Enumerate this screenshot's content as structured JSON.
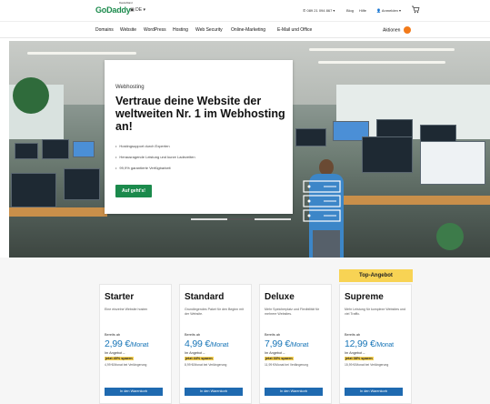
{
  "topbar": {
    "logo": "GoDaddy",
    "logo_tag": "Deutschland",
    "language": "DE",
    "phone": "089 21 094 867",
    "blog": "Blog",
    "help": "Hilfe",
    "account": "Anmelden"
  },
  "nav": {
    "items": [
      "Domains",
      "Website",
      "WordPress",
      "Hosting",
      "Web Security",
      "Online-Marketing",
      "E-Mail und Office"
    ],
    "actions_label": "Aktionen"
  },
  "hero": {
    "eyebrow": "Webhosting",
    "title": "Vertraue deine Website der weltweiten Nr. 1 im Webhosting an!",
    "bullets": [
      "Hostingsupport durch Experten",
      "Herausragende Leistung und kurze Ladezeiten",
      "99,9% garantierte Verfügbarkeit"
    ],
    "cta": "Auf geht's!"
  },
  "pricing": {
    "top_offer": "Top-Angebot",
    "plans": [
      {
        "name": "Starter",
        "desc": "Eine einzelne Website hosten",
        "from": "Bereits ab",
        "price": "2,99 €",
        "unit": "/Monat",
        "offer": "Im Angebot –",
        "save": "jetzt 40% sparen",
        "after": "4,99 €/Monat bei Verlängerung",
        "button": "In den Warenkorb"
      },
      {
        "name": "Standard",
        "desc": "Grundlegendes Paket für den Beginn mit der Website.",
        "from": "Bereits ab",
        "price": "4,99 €",
        "unit": "/Monat",
        "offer": "Im Angebot –",
        "save": "jetzt 44% sparen",
        "after": "8,99 €/Monat bei Verlängerung",
        "button": "In den Warenkorb"
      },
      {
        "name": "Deluxe",
        "desc": "Mehr Speicherplatz und Flexibilität für mehrere Websites.",
        "from": "Bereits ab",
        "price": "7,99 €",
        "unit": "/Monat",
        "offer": "Im Angebot –",
        "save": "jetzt 33% sparen",
        "after": "11,99 €/Monat bei Verlängerung",
        "button": "In den Warenkorb"
      },
      {
        "name": "Supreme",
        "desc": "Mehr Leistung für komplexe Websites und viel Traffic.",
        "from": "Bereits ab",
        "price": "12,99 €",
        "unit": "/Monat",
        "offer": "Im Angebot –",
        "save": "jetzt 38% sparen",
        "after": "15,99 €/Monat bei Verlängerung",
        "button": "In den Warenkorb"
      }
    ]
  },
  "colors": {
    "brand_green": "#1b8a4c",
    "price_blue": "#1976b8",
    "button_blue": "#1f6ab0",
    "highlight_yellow": "#f8d354",
    "actions_orange": "#f27a1a"
  }
}
